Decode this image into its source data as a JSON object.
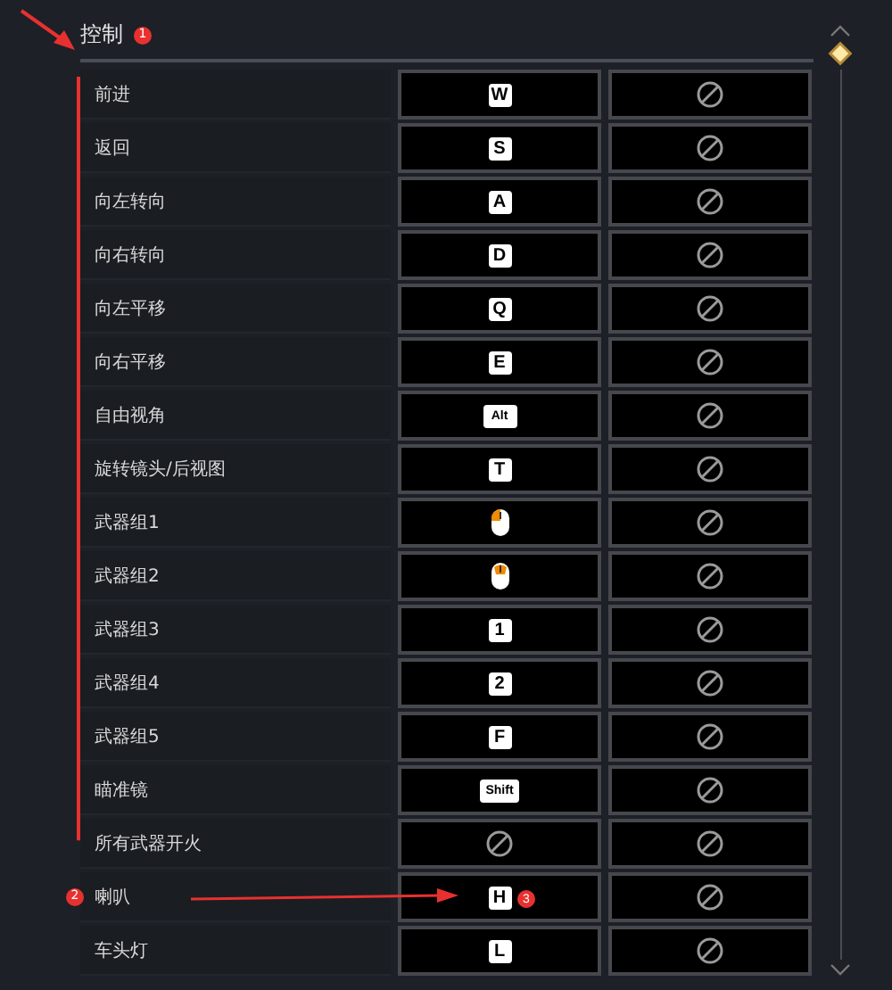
{
  "section": {
    "title": "控制",
    "badge": "1"
  },
  "rows": [
    {
      "action": "前进",
      "primary": {
        "kind": "key",
        "label": "W"
      },
      "secondary": {
        "kind": "none"
      }
    },
    {
      "action": "返回",
      "primary": {
        "kind": "key",
        "label": "S"
      },
      "secondary": {
        "kind": "none"
      }
    },
    {
      "action": "向左转向",
      "primary": {
        "kind": "key",
        "label": "A"
      },
      "secondary": {
        "kind": "none"
      }
    },
    {
      "action": "向右转向",
      "primary": {
        "kind": "key",
        "label": "D"
      },
      "secondary": {
        "kind": "none"
      }
    },
    {
      "action": "向左平移",
      "primary": {
        "kind": "key",
        "label": "Q"
      },
      "secondary": {
        "kind": "none"
      }
    },
    {
      "action": "向右平移",
      "primary": {
        "kind": "key",
        "label": "E"
      },
      "secondary": {
        "kind": "none"
      }
    },
    {
      "action": "自由视角",
      "primary": {
        "kind": "key",
        "label": "Alt"
      },
      "secondary": {
        "kind": "none"
      }
    },
    {
      "action": "旋转镜头/后视图",
      "primary": {
        "kind": "key",
        "label": "T"
      },
      "secondary": {
        "kind": "none"
      }
    },
    {
      "action": "武器组1",
      "primary": {
        "kind": "lmb"
      },
      "secondary": {
        "kind": "none"
      }
    },
    {
      "action": "武器组2",
      "primary": {
        "kind": "mmb"
      },
      "secondary": {
        "kind": "none"
      }
    },
    {
      "action": "武器组3",
      "primary": {
        "kind": "key",
        "label": "1"
      },
      "secondary": {
        "kind": "none"
      }
    },
    {
      "action": "武器组4",
      "primary": {
        "kind": "key",
        "label": "2"
      },
      "secondary": {
        "kind": "none"
      }
    },
    {
      "action": "武器组5",
      "primary": {
        "kind": "key",
        "label": "F"
      },
      "secondary": {
        "kind": "none"
      }
    },
    {
      "action": "瞄准镜",
      "primary": {
        "kind": "key",
        "label": "Shift"
      },
      "secondary": {
        "kind": "none"
      }
    },
    {
      "action": "所有武器开火",
      "primary": {
        "kind": "none"
      },
      "secondary": {
        "kind": "none"
      }
    },
    {
      "action": "喇叭",
      "badge": "2",
      "primary": {
        "kind": "key",
        "label": "H",
        "badge": "3"
      },
      "secondary": {
        "kind": "none"
      }
    },
    {
      "action": "车头灯",
      "primary": {
        "kind": "key",
        "label": "L"
      },
      "secondary": {
        "kind": "none"
      }
    }
  ]
}
